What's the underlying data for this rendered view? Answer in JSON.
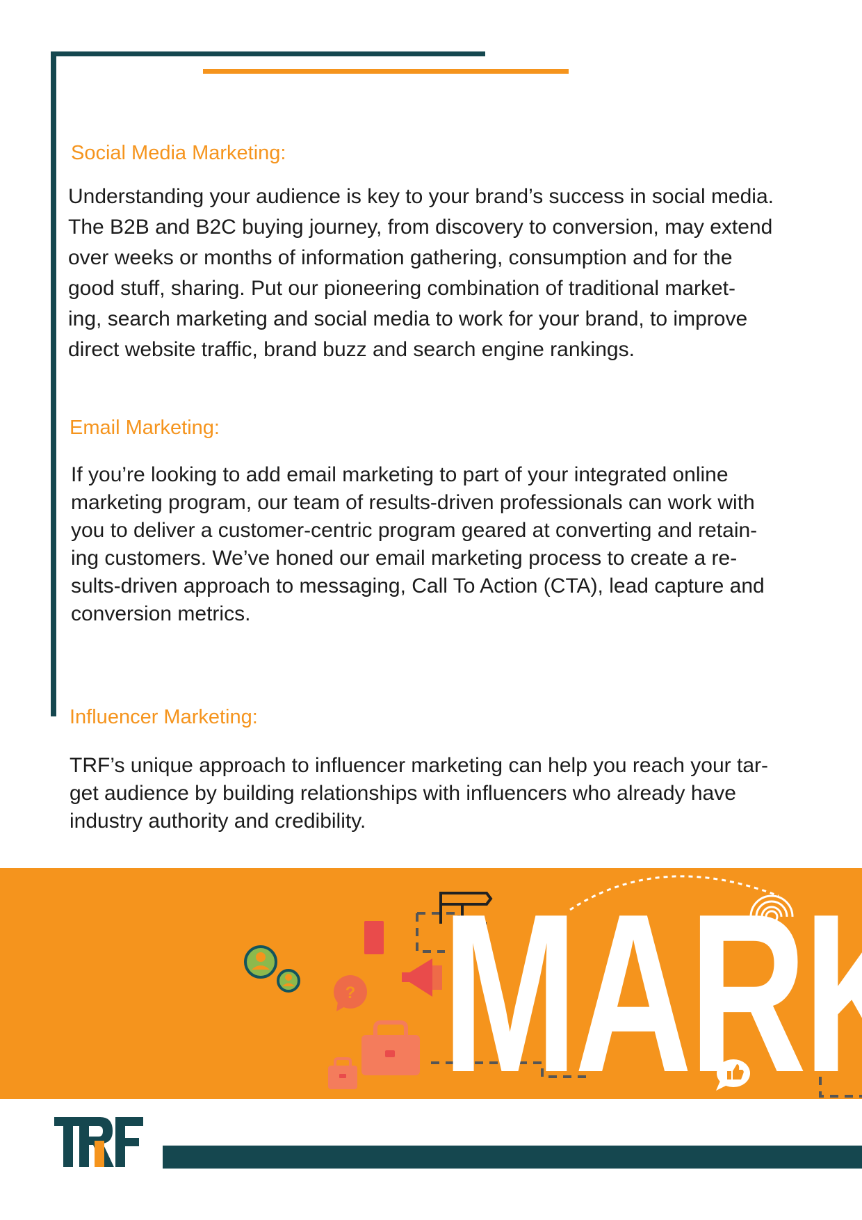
{
  "sections": [
    {
      "heading": "Social Media Marketing:",
      "lines": [
        "Understanding your audience is key to your brand’s success in social media.",
        "The B2B and B2C buying journey, from discovery to conversion, may extend",
        "over weeks or months of information gathering, consumption and for the",
        "good stuff, sharing. Put our pioneering combination of traditional market-",
        "ing, search marketing and social media to work for your brand, to improve",
        "direct website traffic, brand buzz and search engine rankings."
      ]
    },
    {
      "heading": "Email Marketing:",
      "lines": [
        "If you’re looking to add email marketing to part of your integrated online",
        "marketing program, our team of results-driven professionals can work with",
        "you to deliver a customer-centric program geared at converting and retain-",
        "ing customers. We’ve honed our email marketing process to create a re-",
        "sults-driven approach to messaging, Call To Action (CTA), lead capture and",
        "conversion metrics."
      ]
    },
    {
      "heading": "Influencer Marketing:",
      "lines": [
        "TRF’s unique approach to influencer marketing can help you reach your tar-",
        "get audience by building relationships with influencers who already have",
        "industry authority and credibility."
      ]
    }
  ],
  "banner": {
    "word": "MARK",
    "icons": [
      "users-icon",
      "mobile-phone-icon",
      "question-bubble-icon",
      "megaphone-icon",
      "briefcase-icon",
      "thumbs-up-icon",
      "signal-icon",
      "signpost-icon"
    ]
  },
  "logo": {
    "text": "TRF"
  },
  "colors": {
    "accent": "#f5941d",
    "dark": "#15474f",
    "text": "#1b1b1b"
  }
}
